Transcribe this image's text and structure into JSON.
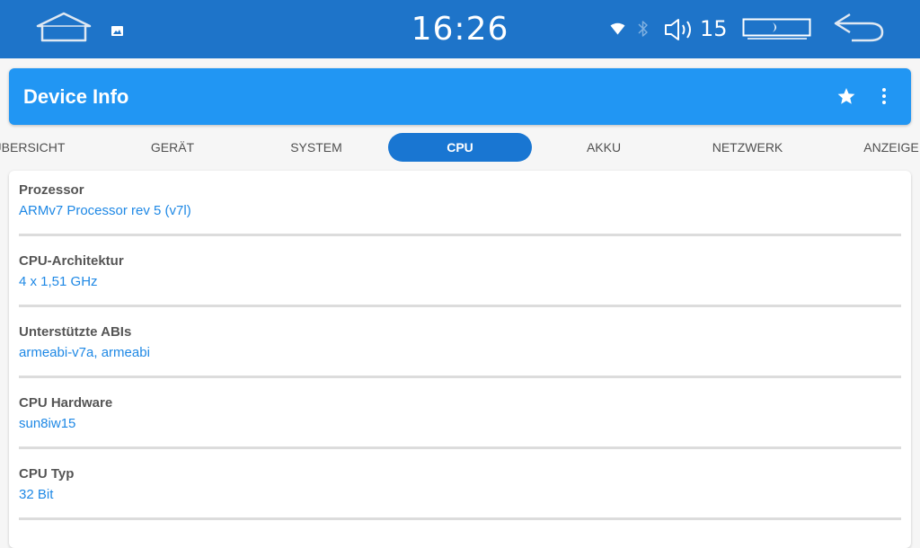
{
  "status_bar": {
    "time": "16:26",
    "volume_level": "15",
    "icons": [
      "home-icon",
      "image-icon",
      "wifi-icon",
      "bluetooth-icon",
      "volume-icon",
      "display-mode-icon",
      "back-arrow-icon"
    ],
    "background": "#1e74c9"
  },
  "app_bar": {
    "title": "Device Info",
    "background": "#2196f3",
    "actions": [
      "star-icon",
      "more-vert-icon"
    ]
  },
  "tabs": {
    "items": [
      "ÜBERSICHT",
      "GERÄT",
      "SYSTEM",
      "CPU",
      "AKKU",
      "NETZWERK",
      "ANZEIGE"
    ],
    "selected": "CPU",
    "active_color": "#1976d2"
  },
  "cpu_info": {
    "items": [
      {
        "label": "Prozessor",
        "value": "ARMv7 Processor rev 5 (v7l)"
      },
      {
        "label": "CPU-Architektur",
        "value": "4 x 1,51 GHz"
      },
      {
        "label": "Unterstützte ABIs",
        "value": "armeabi-v7a, armeabi"
      },
      {
        "label": "CPU Hardware",
        "value": "sun8iw15"
      },
      {
        "label": "CPU Typ",
        "value": "32 Bit"
      }
    ],
    "value_color": "#1e88e5"
  }
}
